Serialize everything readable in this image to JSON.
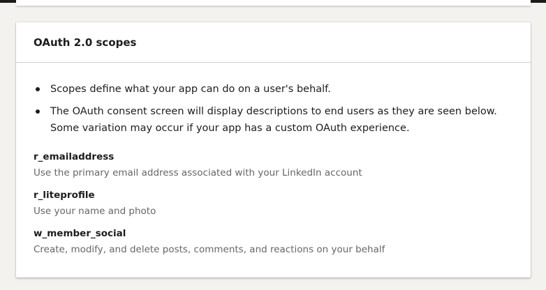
{
  "card": {
    "title": "OAuth 2.0 scopes",
    "bullets": [
      "Scopes define what your app can do on a user's behalf.",
      "The OAuth consent screen will display descriptions to end users as they are seen below. Some variation may occur if your app has a custom OAuth experience."
    ],
    "scopes": [
      {
        "name": "r_emailaddress",
        "description": "Use the primary email address associated with your LinkedIn account"
      },
      {
        "name": "r_liteprofile",
        "description": "Use your name and photo"
      },
      {
        "name": "w_member_social",
        "description": "Create, modify, and delete posts, comments, and reactions on your behalf"
      }
    ]
  }
}
